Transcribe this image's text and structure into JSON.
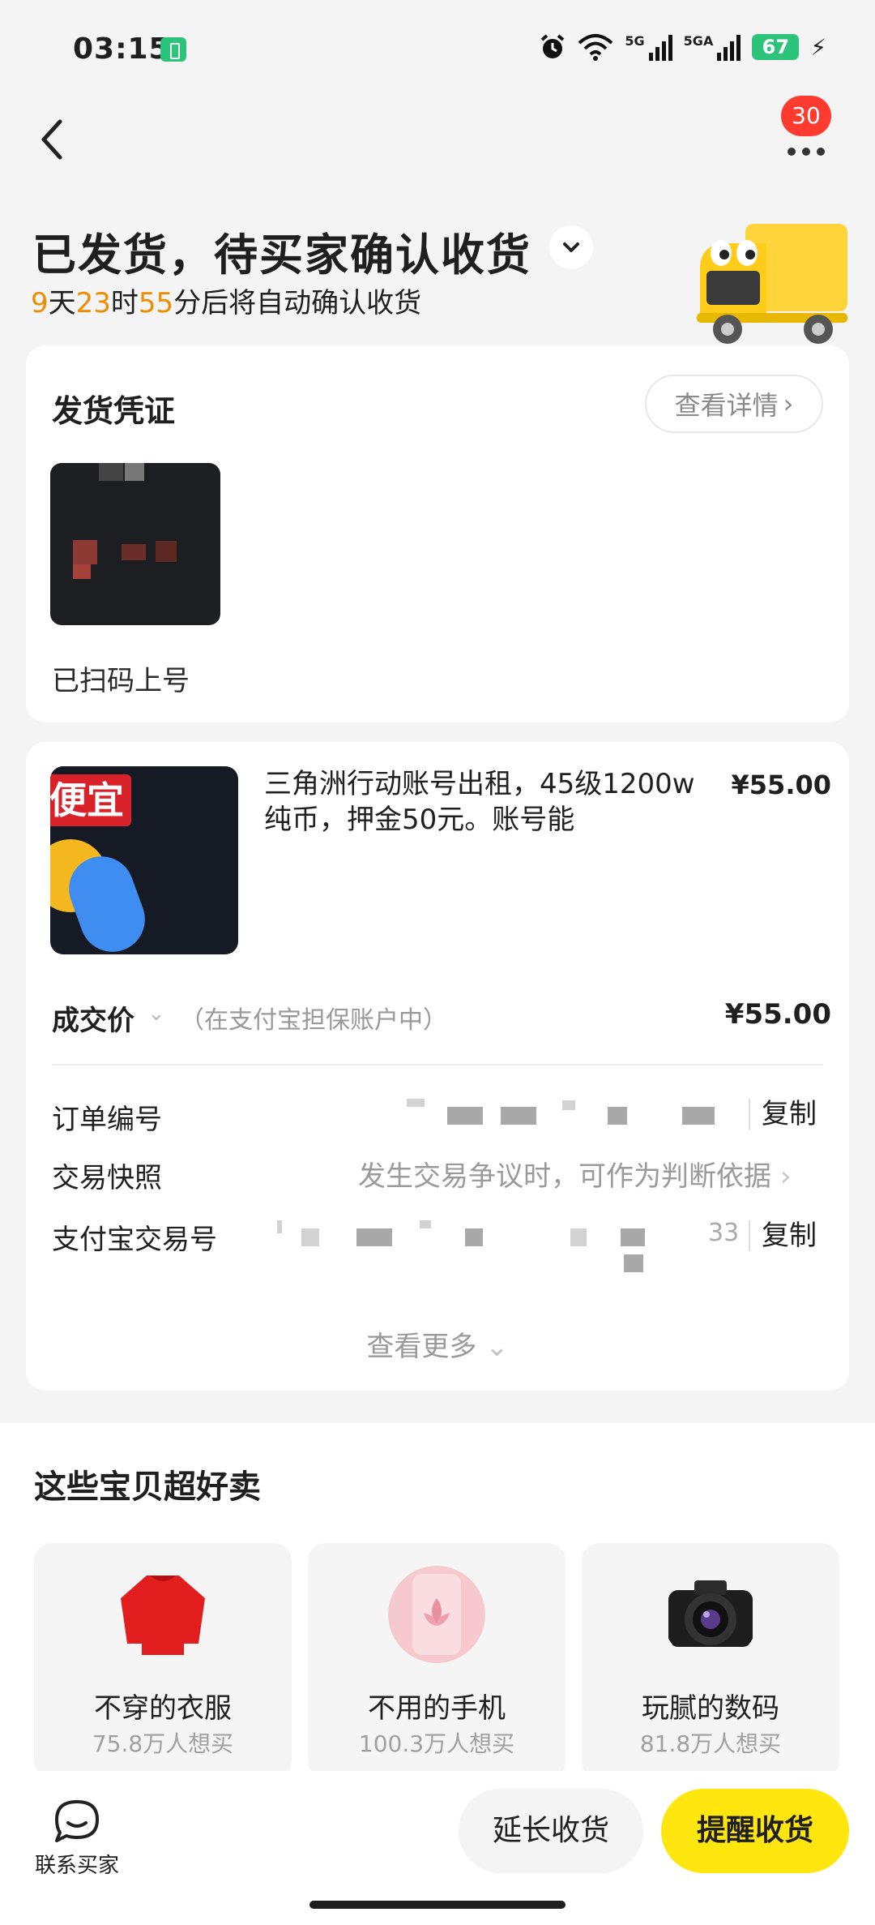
{
  "status_bar": {
    "time": "03:15",
    "network_1": "5G",
    "network_2": "5GA",
    "battery": "67"
  },
  "nav": {
    "back_icon": "chevron-left-icon",
    "more_icon": "more-dots-icon",
    "badge_count": "30"
  },
  "order_status": {
    "title": "已发货，待买家确认收货",
    "countdown_days": "9",
    "countdown_days_unit": "天",
    "countdown_hours": "23",
    "countdown_hours_unit": "时",
    "countdown_minutes": "55",
    "countdown_suffix": "分后将自动确认收货"
  },
  "shipping_proof": {
    "title": "发货凭证",
    "detail_button": "查看详情",
    "proof_label": "已扫码上号"
  },
  "product": {
    "title": "三角洲行动账号出租，45级1200w纯币，押金50元。账号能",
    "price": "¥55.00",
    "image_text": "便宜"
  },
  "deal": {
    "label": "成交价",
    "note": "（在支付宝担保账户中）",
    "price": "¥55.00"
  },
  "order_info": {
    "order_number_label": "订单编号",
    "order_number_copy": "复制",
    "snapshot_label": "交易快照",
    "snapshot_value": "发生交易争议时，可作为判断依据",
    "alipay_label": "支付宝交易号",
    "alipay_tail": "33",
    "alipay_copy": "复制",
    "see_more": "查看更多"
  },
  "recommend": {
    "title": "这些宝贝超好卖",
    "items": [
      {
        "name": "不穿的衣服",
        "stat": "75.8万人想买",
        "icon": "sweater-icon"
      },
      {
        "name": "不用的手机",
        "stat": "100.3万人想买",
        "icon": "phone-icon"
      },
      {
        "name": "玩腻的数码",
        "stat": "81.8万人想买",
        "icon": "camera-icon"
      }
    ]
  },
  "bottom_bar": {
    "contact_label": "联系买家",
    "extend_button": "延长收货",
    "remind_button": "提醒收货"
  },
  "colors": {
    "accent_yellow": "#ffe60f",
    "countdown_orange": "#f08c00",
    "badge_red": "#ff3b30"
  }
}
